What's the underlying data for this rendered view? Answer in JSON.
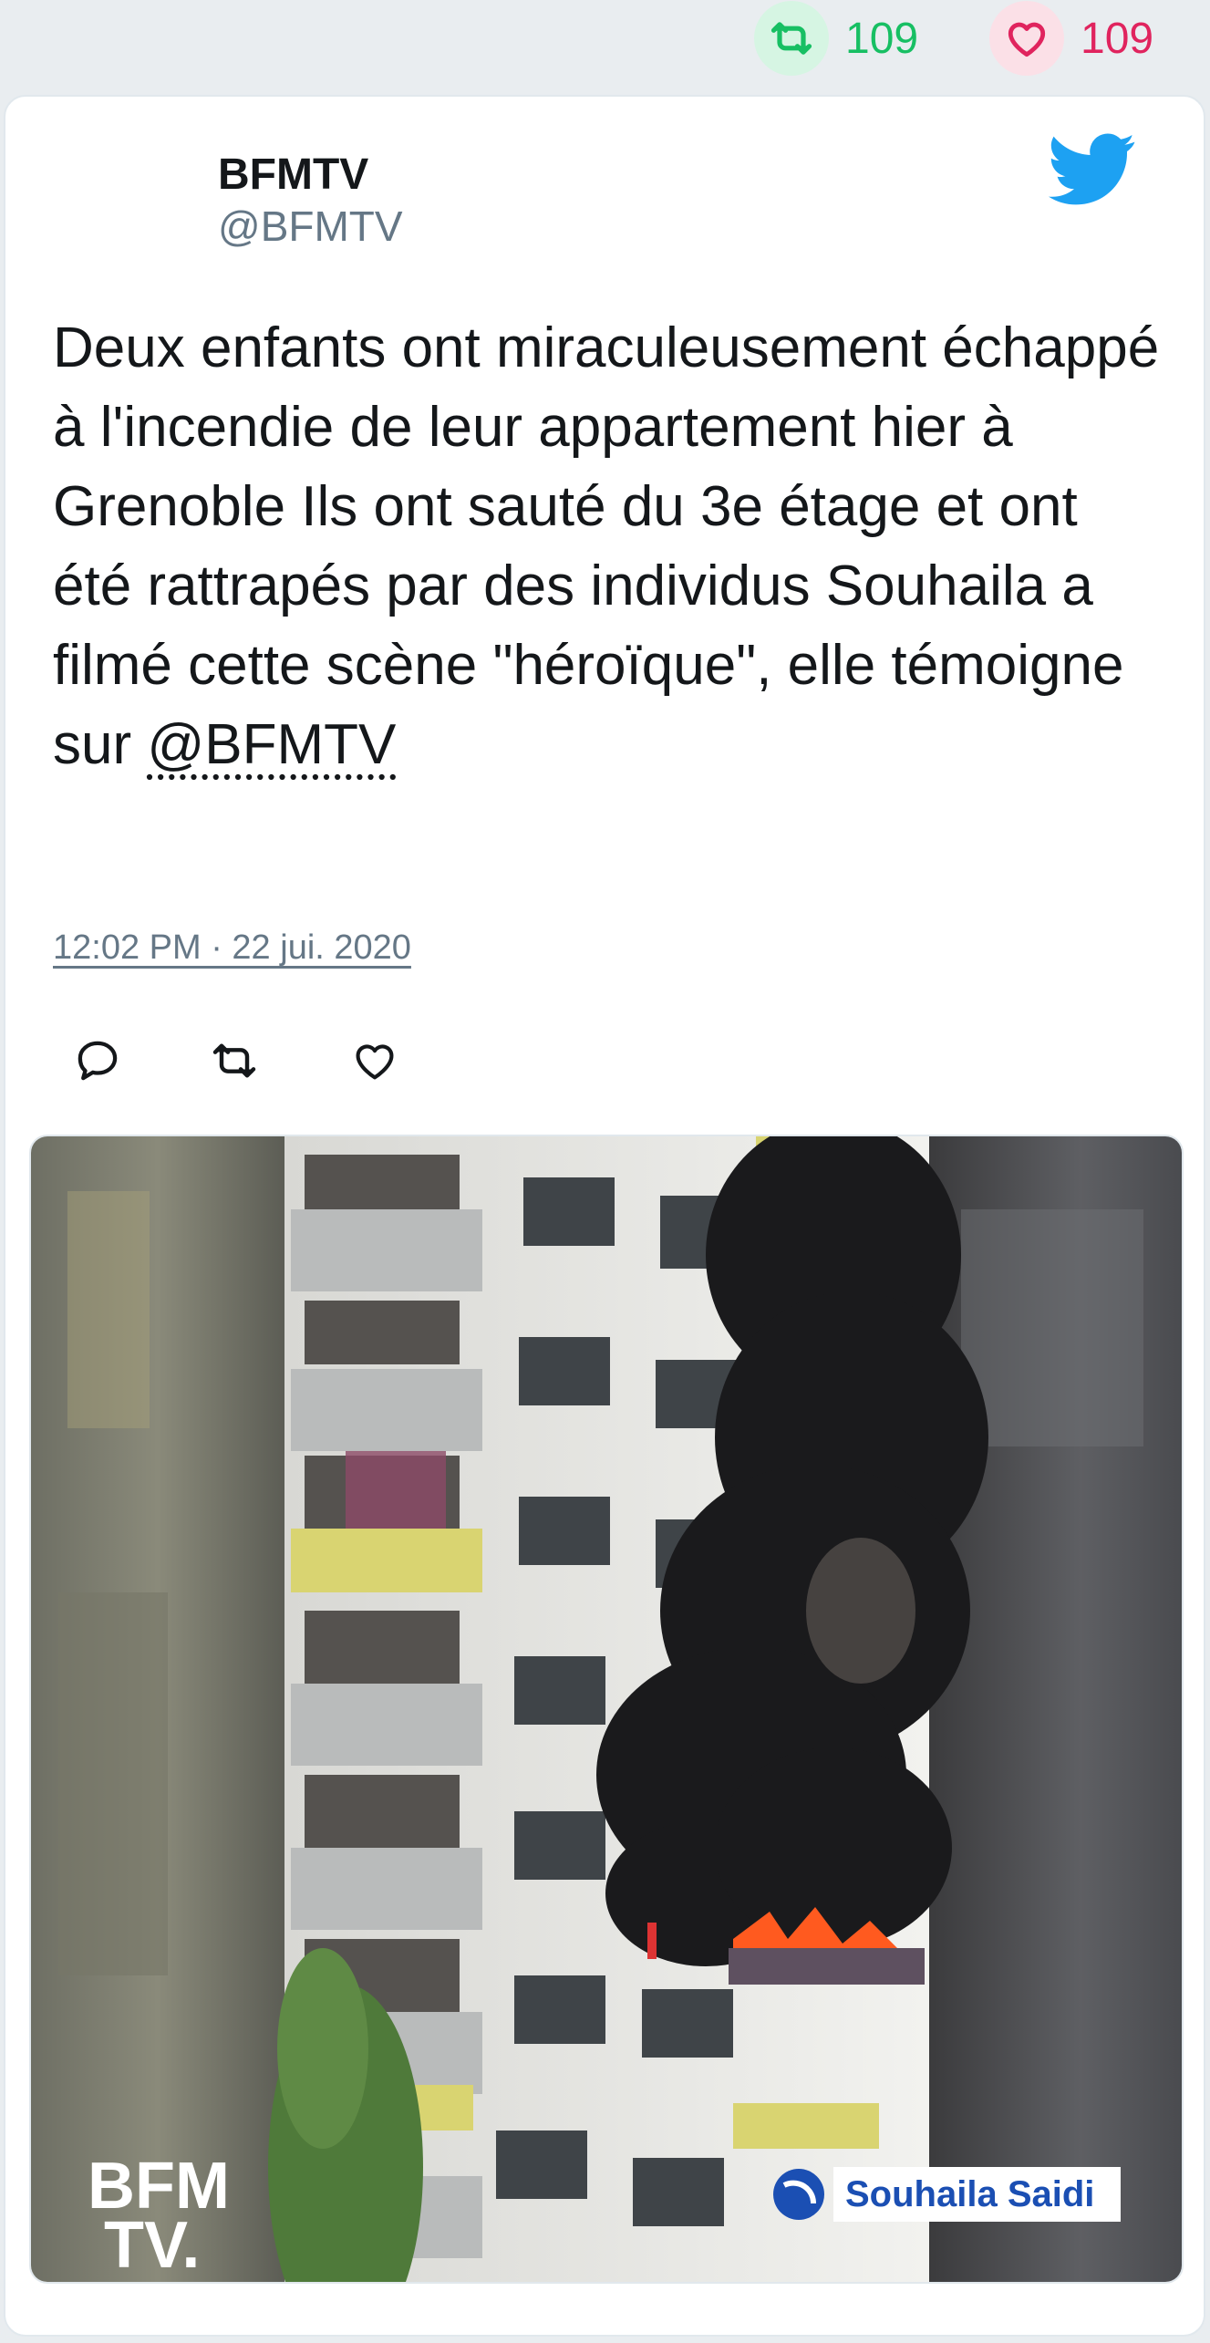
{
  "stats": {
    "retweets": "109",
    "likes": "109"
  },
  "tweet": {
    "author_name": "BFMTV",
    "author_handle": "@BFMTV",
    "text": "Deux enfants ont miraculeusement échappé à l'incendie de leur appartement hier à Grenoble Ils ont sauté du 3e étage et ont été rattrapés par des individus Souhaila a filmé cette scène \"héroïque\", elle témoigne sur ",
    "mention": "@BFMTV",
    "timestamp": "12:02 PM · 22 jui. 2020"
  },
  "media": {
    "watermark_line1": "BFM",
    "watermark_line2": "TV.",
    "credit": "Souhaila Saidi"
  },
  "icons": {
    "retweet": "retweet-icon",
    "like": "heart-icon",
    "brand": "twitter-bird-icon",
    "reply": "reply-icon"
  },
  "colors": {
    "retweet": "#17bf63",
    "like": "#e0245e",
    "brand": "#1da1f2",
    "meta": "#657786"
  }
}
